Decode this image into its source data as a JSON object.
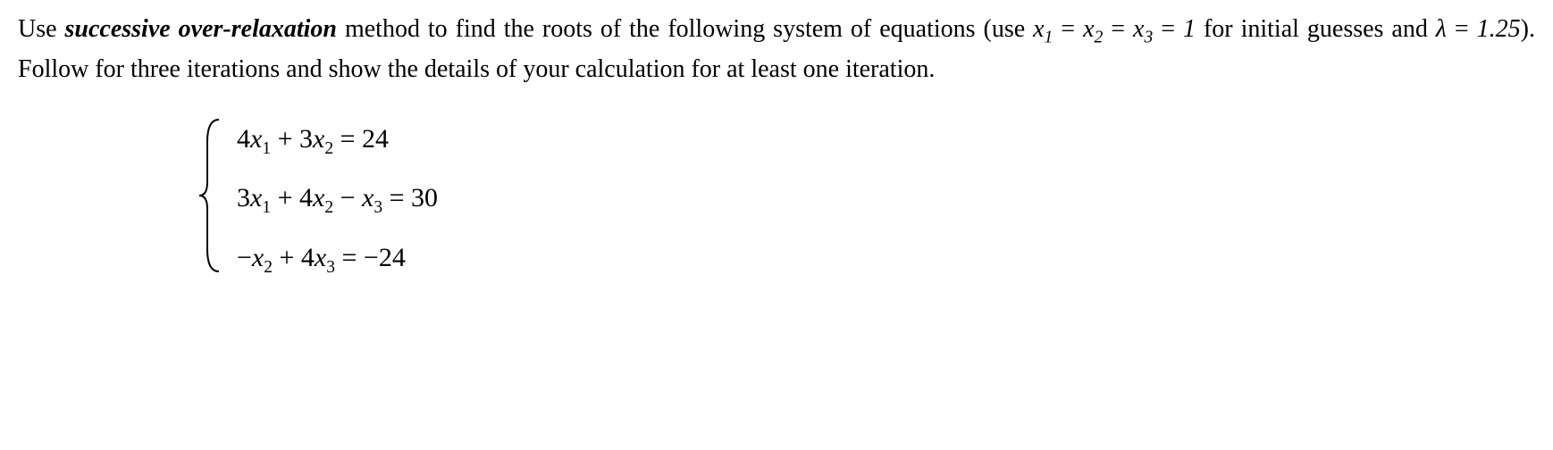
{
  "problem": {
    "text_parts": {
      "p1": "Use ",
      "method": "successive over-relaxation",
      "p2": " method to find the roots of the following system of equations (use ",
      "var_x1": "x",
      "sub_1": "1",
      "eq_sign": " = ",
      "var_x2": "x",
      "sub_2": "2",
      "var_x3": "x",
      "sub_3": "3",
      "initial_val": "1",
      "p3": " for initial guesses and ",
      "lambda": "λ",
      "lambda_val": "1.25",
      "p4": "). Follow for three iterations and show the details of your calculation for at least one iteration."
    }
  },
  "equations": {
    "eq1": {
      "t1": "4",
      "v1": "x",
      "s1": "1",
      "op1": " + 3",
      "v2": "x",
      "s2": "2",
      "rhs": " = 24"
    },
    "eq2": {
      "t1": "3",
      "v1": "x",
      "s1": "1",
      "op1": " + 4",
      "v2": "x",
      "s2": "2",
      "op2": " − ",
      "v3": "x",
      "s3": "3",
      "rhs": " = 30"
    },
    "eq3": {
      "t1": "−",
      "v1": "x",
      "s1": "2",
      "op1": " + 4",
      "v2": "x",
      "s2": "3",
      "rhs": " = −24"
    }
  }
}
